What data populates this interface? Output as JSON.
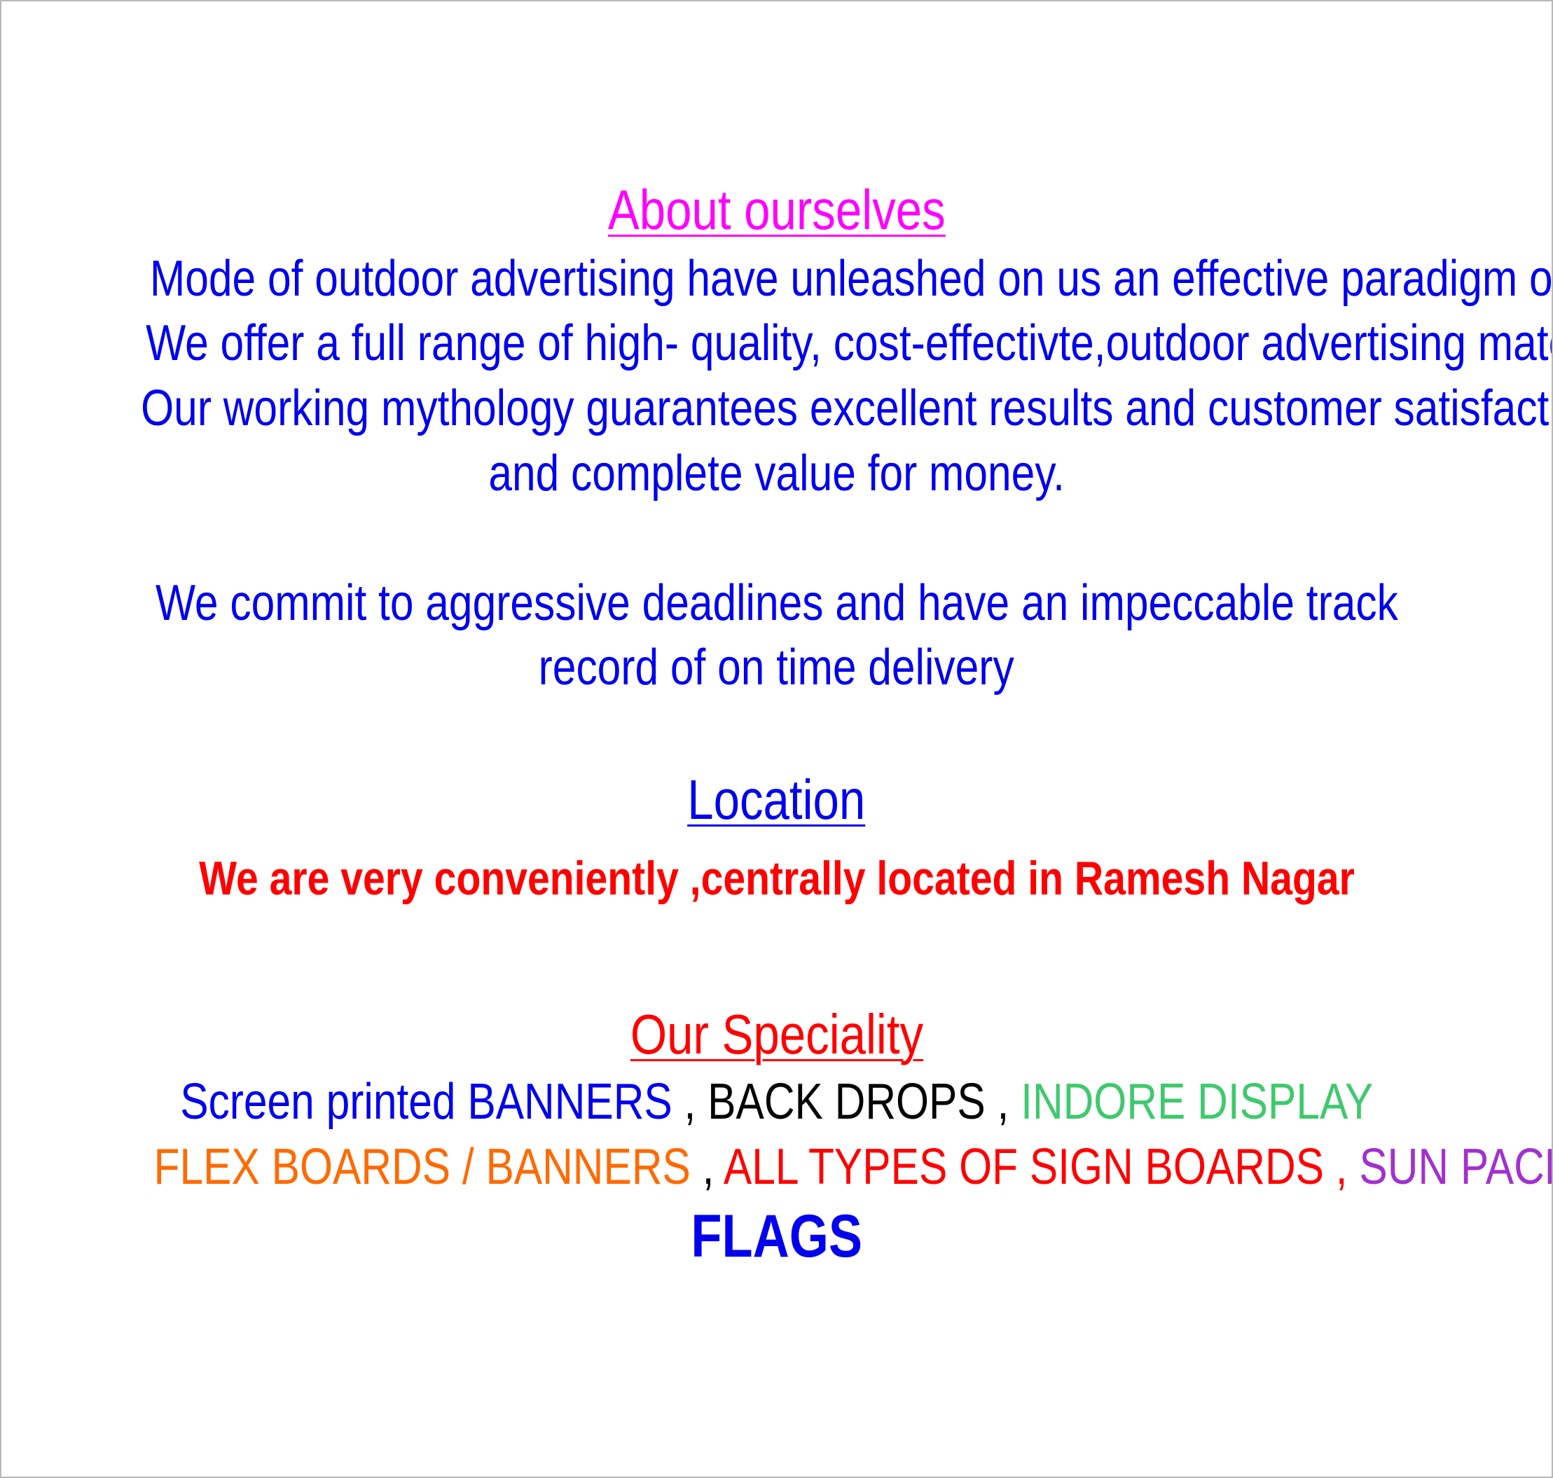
{
  "about": {
    "heading": "About ourselves",
    "lines": [
      "Mode of outdoor advertising have unleashed on us an effective paradigm of selling.",
      "We offer a full range of high- quality, cost-effectivte,outdoor advertising materials,",
      "Our working mythology guarantees excellent results and customer satisfaction",
      "and complete value for money."
    ],
    "commitment_lines": [
      "We commit to aggressive deadlines and have an impeccable track",
      "record of on time delivery"
    ]
  },
  "location": {
    "heading": "Location",
    "text": "We are very conveniently ,centrally located in Ramesh Nagar"
  },
  "speciality": {
    "heading": "Our Speciality",
    "line1": {
      "item1": "Screen printed BANNERS",
      "sep1": " , ",
      "item2": "BACK DROPS",
      "sep2": " , ",
      "item3": "INDORE DISPLAY"
    },
    "line2": {
      "item1": "FLEX BOARDS / BANNERS",
      "sep1": " , ",
      "item2": "ALL TYPES OF SIGN BOARDS",
      "sep2": " , ",
      "item3": "SUN PACK SHEETS"
    },
    "flags": "FLAGS"
  },
  "colors": {
    "about_heading": "#ff00ff",
    "body_text": "#0000ee",
    "location_text": "#ff0000",
    "speciality_heading": "#ff0000",
    "indore_display": "#3fc96d",
    "flex_boards": "#ff6a00",
    "sun_pack_sheets": "#a230d0",
    "page_border": "#b8b8b8"
  }
}
